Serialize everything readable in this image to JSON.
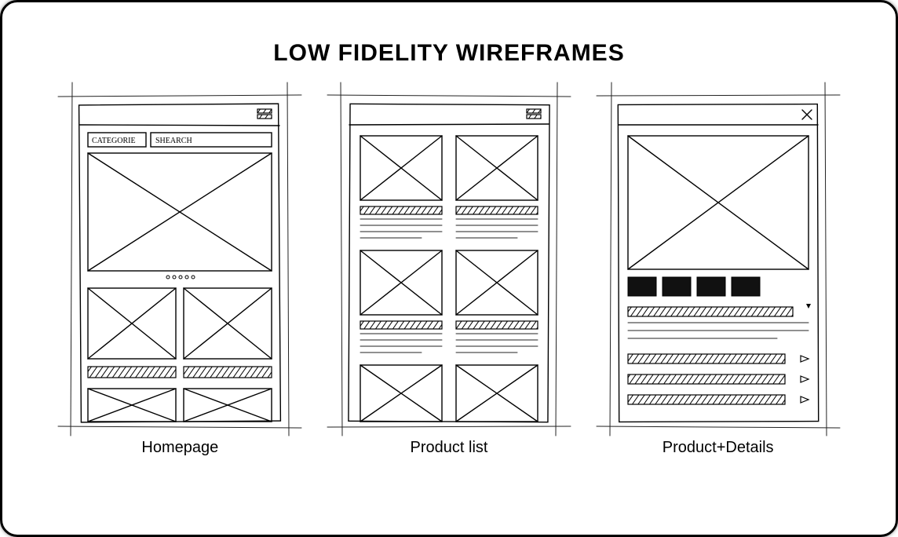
{
  "title": "LOW FIDELITY WIREFRAMES",
  "frames": [
    {
      "caption": "Homepage",
      "categorie_label": "CATEGORIE",
      "search_label": "SHEARCH"
    },
    {
      "caption": "Product list"
    },
    {
      "caption": "Product+Details"
    }
  ]
}
